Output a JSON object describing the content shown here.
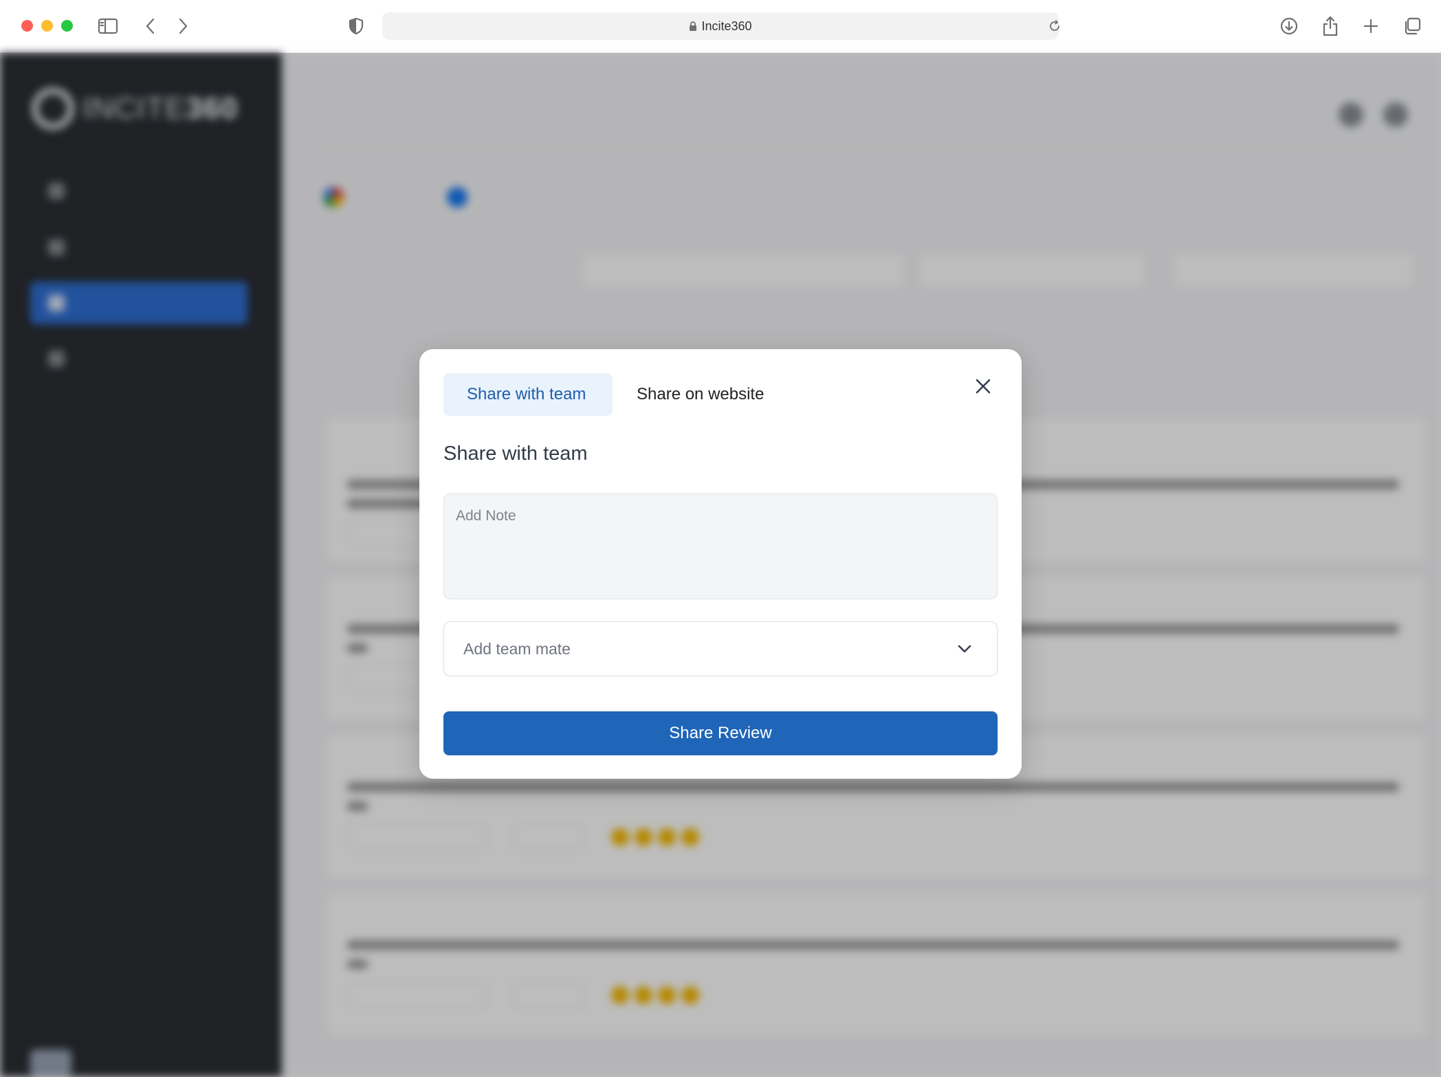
{
  "browser": {
    "url": "Incite360",
    "icons": [
      "sidebar-toggle-icon",
      "back-arrow-icon",
      "forward-arrow-icon",
      "privacy-shield-icon",
      "lock-icon",
      "reload-icon",
      "download-icon",
      "share-icon",
      "new-tab-plus-icon",
      "tab-overview-icon"
    ]
  },
  "modal": {
    "tabs": [
      "Share with team",
      "Share on website"
    ],
    "heading": "Share with team",
    "note_placeholder": "Add Note",
    "teammate_placeholder": "Add team mate",
    "submit_label": "Share Review"
  },
  "colors": {
    "primary": "#1f65b8",
    "active_tab_bg": "#eaf2fc",
    "active_tab_text": "#1e5eab",
    "sidebar_bg": "#2a2d33",
    "sidebar_active": "#2f6fd3",
    "star": "#f5b800"
  }
}
